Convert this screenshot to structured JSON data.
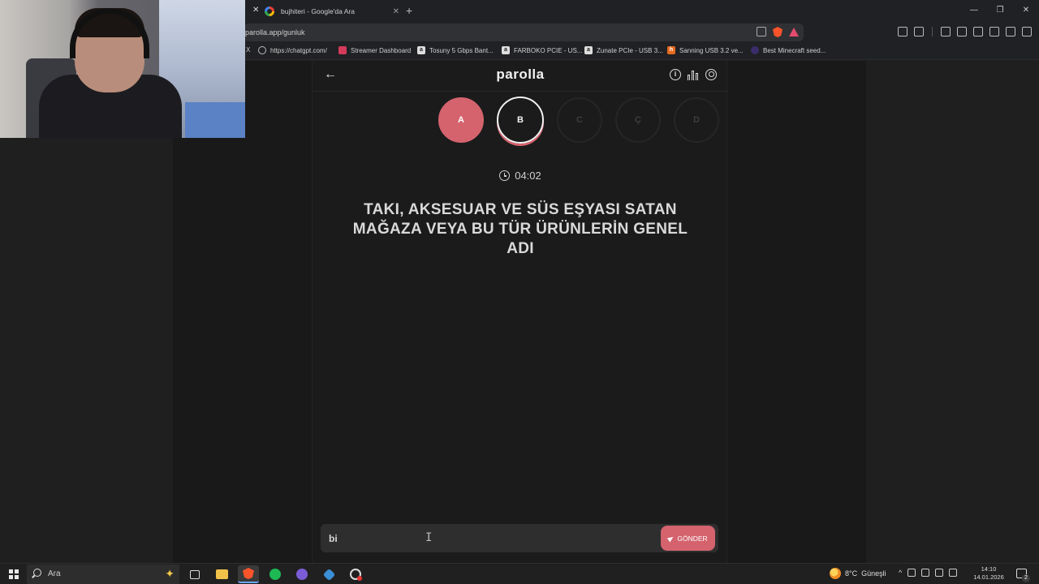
{
  "browser": {
    "tab": {
      "title": "bujhiteri - Google'da Ara"
    },
    "url": "parolla.app/gunluk",
    "bookmarks": [
      {
        "label": "X"
      },
      {
        "label": "https://chatgpt.com/"
      },
      {
        "label": "Streamer Dashboard"
      },
      {
        "label": "Tosuny 5 Gbps Bant..."
      },
      {
        "label": "FARBOKO PCIE - US..."
      },
      {
        "label": "Zunate PCIe - USB 3..."
      },
      {
        "label": "Sanning USB 3.2 ve..."
      },
      {
        "label": "Best Minecraft seed..."
      }
    ]
  },
  "app": {
    "logo": "parolla",
    "letters": [
      {
        "letter": "A",
        "state": "done"
      },
      {
        "letter": "B",
        "state": "current"
      },
      {
        "letter": "C",
        "state": "pending"
      },
      {
        "letter": "Ç",
        "state": "pending"
      },
      {
        "letter": "D",
        "state": "pending"
      }
    ],
    "timer": "04:02",
    "question": "TAKI, AKSESUAR VE SÜS EŞYASI SATAN MAĞAZA VEYA BU TÜR ÜRÜNLERİN GENEL ADI",
    "answer": {
      "value": "bi"
    },
    "send_label": "GÖNDER",
    "accent_color": "#d4636e"
  },
  "taskbar": {
    "search_placeholder": "Ara",
    "weather": {
      "temp": "8°C",
      "text": "Güneşli"
    },
    "time": "14:10",
    "date": "14.01.2026",
    "notification_count": "2"
  }
}
